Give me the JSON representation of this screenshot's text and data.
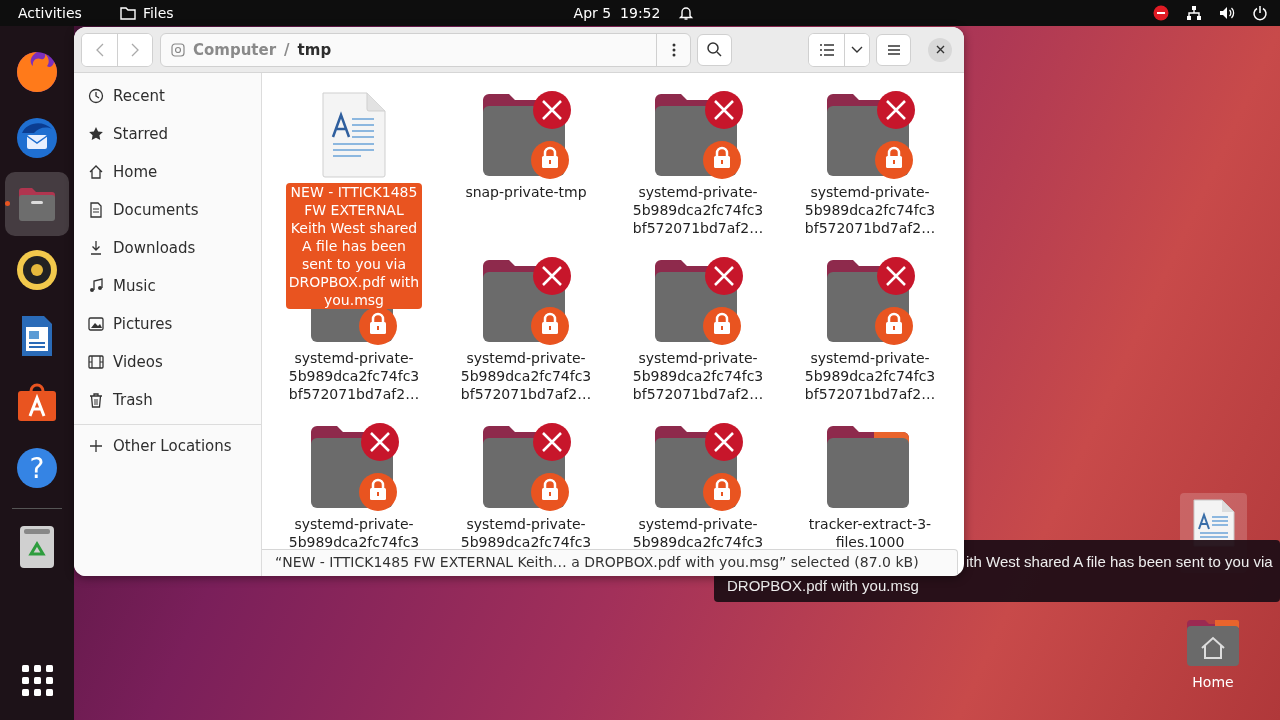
{
  "top_bar": {
    "activities": "Activities",
    "app_name": "Files",
    "clock": "Apr 5  19:52"
  },
  "dock": {
    "items": [
      {
        "kind": "firefox",
        "running": false
      },
      {
        "kind": "thunderbird",
        "running": false
      },
      {
        "kind": "files",
        "running": true
      },
      {
        "kind": "rhythmbox",
        "running": false
      },
      {
        "kind": "writer",
        "running": false
      },
      {
        "kind": "app_center",
        "running": false
      },
      {
        "kind": "help",
        "running": false,
        "glyph": "?"
      }
    ]
  },
  "window": {
    "path": [
      {
        "label": "Computer",
        "current": false
      },
      {
        "label": "tmp",
        "current": true
      }
    ],
    "path_separator": "/",
    "sidebar": {
      "places": [
        {
          "label": "Recent"
        },
        {
          "label": "Starred"
        },
        {
          "label": "Home"
        },
        {
          "label": "Documents"
        },
        {
          "label": "Downloads"
        },
        {
          "label": "Music"
        },
        {
          "label": "Pictures"
        },
        {
          "label": "Videos"
        },
        {
          "label": "Trash"
        }
      ],
      "other_locations": "Other Locations"
    },
    "files": [
      {
        "kind": "document",
        "selected": true,
        "name_lines": [
          "NEW - ITTICK1485",
          "FW EXTERNAL",
          "Keith West shared",
          "A file has been",
          "sent to you via",
          "DROPBOX.pdf with",
          "you.msg"
        ]
      },
      {
        "kind": "locked_folder",
        "selected": false,
        "name_lines": [
          "snap-private-tmp"
        ]
      },
      {
        "kind": "locked_folder",
        "selected": false,
        "name_lines": [
          "systemd-private-",
          "5b989dca2fc74fc3",
          "bf572071bd7af2…"
        ]
      },
      {
        "kind": "locked_folder",
        "selected": false,
        "name_lines": [
          "systemd-private-",
          "5b989dca2fc74fc3",
          "bf572071bd7af2…"
        ]
      },
      {
        "kind": "locked_folder",
        "selected": false,
        "name_lines": [
          "systemd-private-",
          "5b989dca2fc74fc3",
          "bf572071bd7af2…"
        ]
      },
      {
        "kind": "locked_folder",
        "selected": false,
        "name_lines": [
          "systemd-private-",
          "5b989dca2fc74fc3",
          "bf572071bd7af2…"
        ]
      },
      {
        "kind": "locked_folder",
        "selected": false,
        "name_lines": [
          "systemd-private-",
          "5b989dca2fc74fc3",
          "bf572071bd7af2…"
        ]
      },
      {
        "kind": "locked_folder",
        "selected": false,
        "name_lines": [
          "systemd-private-",
          "5b989dca2fc74fc3",
          "bf572071bd7af2…"
        ]
      },
      {
        "kind": "locked_folder",
        "selected": false,
        "name_lines": [
          "systemd-private-",
          "5b989dca2fc74fc3"
        ]
      },
      {
        "kind": "locked_folder",
        "selected": false,
        "name_lines": [
          "systemd-private-",
          "5b989dca2fc74fc3"
        ]
      },
      {
        "kind": "locked_folder",
        "selected": false,
        "name_lines": [
          "systemd-private-",
          "5b989dca2fc74fc3"
        ]
      },
      {
        "kind": "folder",
        "selected": false,
        "name_lines": [
          "tracker-extract-3-",
          "files.1000"
        ]
      }
    ],
    "status": "“NEW - ITTICK1485 FW EXTERNAL Keith… a DROPBOX.pdf with you.msg” selected (87.0 kB)"
  },
  "desktop": {
    "tooltip_lines": [
      "ith West shared A file has been sent to you via",
      "DROPBOX.pdf with you.msg"
    ],
    "icons": [
      {
        "kind": "document",
        "selected": true
      },
      {
        "kind": "home",
        "selected": false,
        "label": "Home"
      }
    ]
  }
}
